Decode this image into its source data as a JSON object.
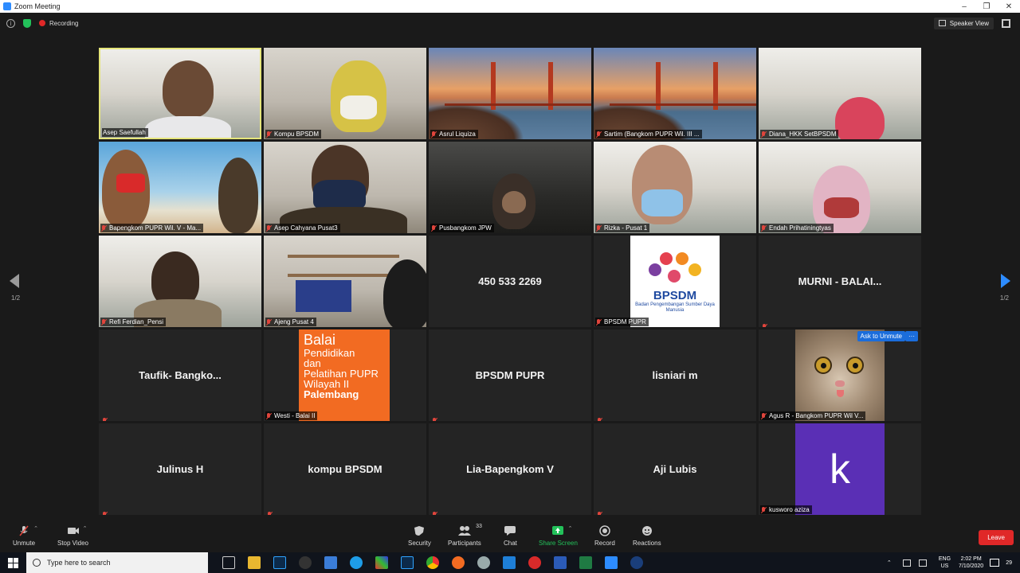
{
  "window": {
    "title": "Zoom Meeting"
  },
  "topbar": {
    "recording_label": "Recording",
    "speaker_view_label": "Speaker View"
  },
  "nav": {
    "page_indicator": "1/2"
  },
  "tiles": [
    {
      "name": "Asep Saefullah",
      "type": "video",
      "active": true
    },
    {
      "name": "Kompu BPSDM",
      "type": "video"
    },
    {
      "name": "Asrul Liquiza",
      "type": "video"
    },
    {
      "name": "Sartim (Bangkom PUPR Wil. III ...",
      "type": "video"
    },
    {
      "name": "Diana_HKK SetBPSDM",
      "type": "video"
    },
    {
      "name": "Bapengkom PUPR Wil. V - Ma...",
      "type": "video"
    },
    {
      "name": "Asep Cahyana Pusat3",
      "type": "video"
    },
    {
      "name": "Pusbangkom JPW",
      "type": "video"
    },
    {
      "name": "Rizka - Pusat 1",
      "type": "video"
    },
    {
      "name": "Endah Prihatiningtyas",
      "type": "video"
    },
    {
      "name": "Refi Ferdian_Pensi",
      "type": "video"
    },
    {
      "name": "Ajeng Pusat 4",
      "type": "video"
    },
    {
      "name": "450 533 2269",
      "type": "text"
    },
    {
      "name": "BPSDM PUPR",
      "type": "image"
    },
    {
      "name": "MURNI - BALAI...",
      "type": "text"
    },
    {
      "name": "Taufik- Bangko...",
      "type": "text"
    },
    {
      "name": "Westi - Balai II",
      "type": "image"
    },
    {
      "name": "BPSDM PUPR",
      "type": "text"
    },
    {
      "name": "lisniari m",
      "type": "text"
    },
    {
      "name": "Agus R - Bangkom PUPR Wil V...",
      "type": "image"
    },
    {
      "name": "Julinus H",
      "type": "text"
    },
    {
      "name": "kompu BPSDM",
      "type": "text"
    },
    {
      "name": "Lia-Bapengkom V",
      "type": "text"
    },
    {
      "name": "Aji Lubis",
      "type": "text"
    },
    {
      "name": "kusworo aziza",
      "type": "image"
    }
  ],
  "bpsdm_logo": {
    "title": "BPSDM",
    "subtitle": "Badan Pengembangan Sumber Daya Manusia"
  },
  "balai_card": {
    "line1": "Balai",
    "line2": "Pendidikan\ndan\nPelatihan PUPR\nWilayah II",
    "line3": "Palembang"
  },
  "cat_tile": {
    "ask_unmute": "Ask to Unmute",
    "more": "···"
  },
  "k_avatar": {
    "letter": "k"
  },
  "toolbar": {
    "unmute": "Unmute",
    "stop_video": "Stop Video",
    "security": "Security",
    "participants": "Participants",
    "participants_count": "33",
    "chat": "Chat",
    "share_screen": "Share Screen",
    "record": "Record",
    "reactions": "Reactions",
    "leave": "Leave"
  },
  "taskbar": {
    "search_placeholder": "Type here to search",
    "lang_line1": "ENG",
    "lang_line2": "US",
    "time": "2:02 PM",
    "date": "7/10/2020",
    "notif_count": "29"
  },
  "colors": {
    "accent": "#2d8cff",
    "leave": "#e02828",
    "share": "#23c15a",
    "active_border": "#e5e57a"
  }
}
